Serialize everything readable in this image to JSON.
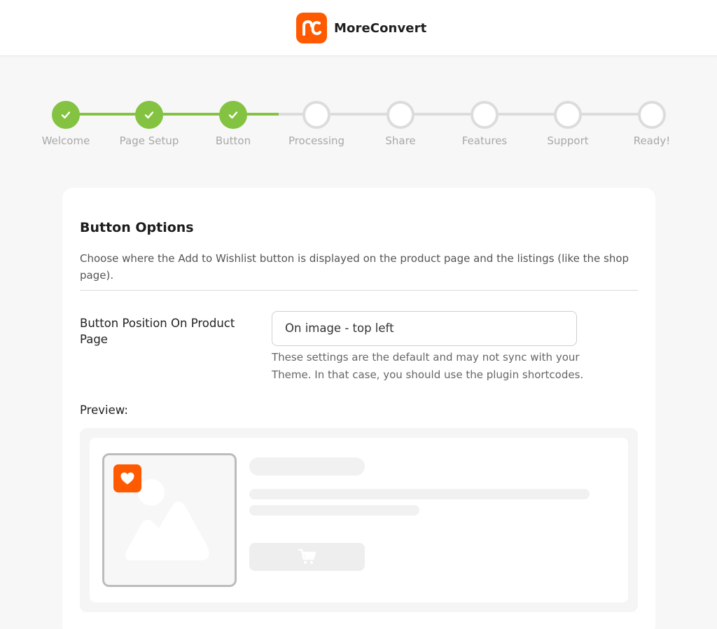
{
  "header": {
    "brand_name": "MoreConvert",
    "logo_icon": "moreconvert-logo-icon",
    "brand_color": "#ff5a00"
  },
  "stepper": {
    "done_color": "#84c341",
    "todo_color": "#dcdcdc",
    "current_step_index": 2,
    "steps": [
      {
        "label": "Welcome",
        "done": true
      },
      {
        "label": "Page Setup",
        "done": true
      },
      {
        "label": "Button",
        "done": true
      },
      {
        "label": "Processing",
        "done": false
      },
      {
        "label": "Share",
        "done": false
      },
      {
        "label": "Features",
        "done": false
      },
      {
        "label": "Support",
        "done": false
      },
      {
        "label": "Ready!",
        "done": false
      }
    ]
  },
  "card": {
    "title": "Button Options",
    "description": "Choose where the Add to Wishlist button is displayed on the product page and the listings (like the shop page).",
    "field": {
      "label": "Button Position On Product Page",
      "value": "On image - top left",
      "hint": "These settings are the default and may not sync with your Theme. In that case, you should use the plugin shortcodes."
    },
    "preview": {
      "label": "Preview:",
      "wishlist_icon": "heart-icon",
      "image_icon": "image-placeholder-icon",
      "cart_icon": "cart-icon"
    }
  }
}
